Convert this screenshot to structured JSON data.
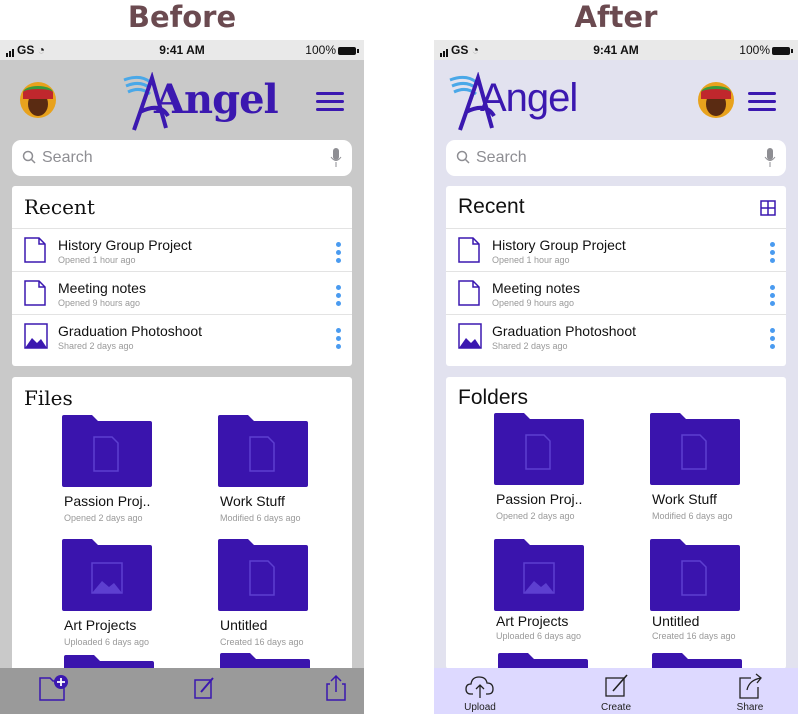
{
  "headings": {
    "before": "Before",
    "after": "After"
  },
  "status_bar": {
    "carrier": "GS",
    "time": "9:41 AM",
    "battery": "100%"
  },
  "app": {
    "logo_text": "Angel",
    "brand_color": "#3b18b0"
  },
  "search": {
    "placeholder": "Search"
  },
  "recent": {
    "title": "Recent",
    "items": [
      {
        "name": "History Group Project",
        "meta": "Opened 1 hour ago",
        "icon": "document-icon"
      },
      {
        "name": "Meeting notes",
        "meta": "Opened 9 hours ago",
        "icon": "document-icon"
      },
      {
        "name": "Graduation Photoshoot",
        "meta": "Shared 2 days ago",
        "icon": "image-icon"
      }
    ]
  },
  "files_before": {
    "title": "Files",
    "items": [
      {
        "name": "Passion Proj..",
        "meta": "Opened 2 days ago",
        "icon": "folder-document-icon"
      },
      {
        "name": "Work Stuff",
        "meta": "Modified 6 days ago",
        "icon": "folder-document-icon"
      },
      {
        "name": "Art Projects",
        "meta": "Uploaded 6 days ago",
        "icon": "folder-image-icon"
      },
      {
        "name": "Untitled",
        "meta": "Created 16 days ago",
        "icon": "folder-document-icon"
      }
    ]
  },
  "files_after": {
    "title": "Folders",
    "items": [
      {
        "name": "Passion Proj..",
        "meta": "Opened 2 days ago",
        "icon": "folder-document-icon"
      },
      {
        "name": "Work Stuff",
        "meta": "Modified 6 days ago",
        "icon": "folder-document-icon"
      },
      {
        "name": "Art Projects",
        "meta": "Uploaded 6 days ago",
        "icon": "folder-image-icon"
      },
      {
        "name": "Untitled",
        "meta": "Created 16 days ago",
        "icon": "folder-document-icon"
      }
    ]
  },
  "toolbar_after": {
    "upload": "Upload",
    "create": "Create",
    "share": "Share"
  },
  "colors": {
    "accent": "#3b18b0",
    "folder": "#3a14ad",
    "dots": "#4a9bf0",
    "after_bg": "#e2e2ef",
    "after_toolbar": "#ddd9ff",
    "before_bg": "#c9c9c9",
    "before_toolbar": "#9a9a9a"
  }
}
